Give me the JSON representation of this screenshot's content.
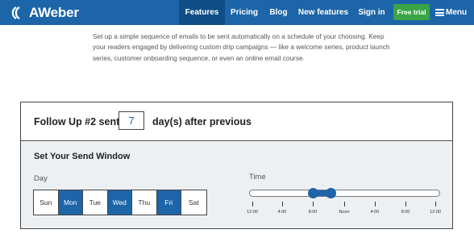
{
  "nav": {
    "logo_text": "AWeber",
    "items": [
      {
        "label": "Features",
        "active": true
      },
      {
        "label": "Pricing",
        "active": false
      },
      {
        "label": "Blog",
        "active": false
      },
      {
        "label": "New features",
        "active": false
      },
      {
        "label": "Sign in",
        "active": false
      }
    ],
    "trial_label": "Free trial",
    "menu_label": "Menu"
  },
  "intro": {
    "text": "Set up a simple sequence of emails to be sent automatically on a schedule of your choosing. Keep your readers engaged by delivering custom drip campaigns — like a welcome series, product launch series, customer onboarding sequence, or even an online email course."
  },
  "follow_up": {
    "label": "Follow Up #2 sent",
    "days_value": "7",
    "suffix": "day(s) after previous"
  },
  "send_window": {
    "title": "Set Your Send Window",
    "day_label": "Day",
    "time_label": "Time",
    "days": [
      {
        "label": "Sun",
        "selected": false
      },
      {
        "label": "Mon",
        "selected": true
      },
      {
        "label": "Tue",
        "selected": false
      },
      {
        "label": "Wed",
        "selected": true
      },
      {
        "label": "Thu",
        "selected": false
      },
      {
        "label": "Fri",
        "selected": true
      },
      {
        "label": "Sat",
        "selected": false
      }
    ],
    "time_ticks": [
      "12:00",
      "4:00",
      "8:00",
      "Noon",
      "4:00",
      "8:00",
      "12:00"
    ],
    "range": {
      "start": "8:00",
      "end": "Noon"
    }
  },
  "colors": {
    "brand_blue": "#1c65a8",
    "nav_active": "#0f4d86",
    "trial_green": "#3aa547",
    "panel_gray": "#edf0f3"
  }
}
